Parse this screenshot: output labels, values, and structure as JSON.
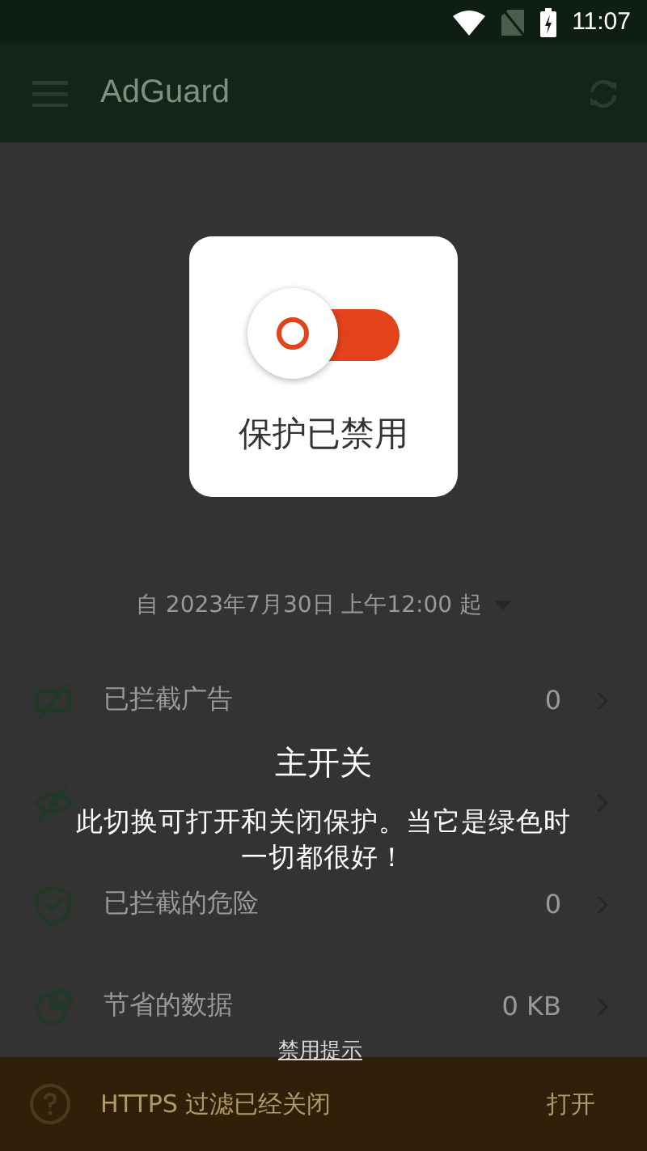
{
  "status_bar": {
    "time": "11:07"
  },
  "toolbar": {
    "title": "AdGuard"
  },
  "protection_card": {
    "on": false,
    "label": "保护已禁用"
  },
  "date_filter": "自 2023年7月30日 上午12:00 起",
  "stats": [
    {
      "kind": "ads",
      "label": "已拦截广告",
      "value": "0"
    },
    {
      "kind": "trackers"
    },
    {
      "kind": "threats",
      "label": "已拦截的危险",
      "value": "0"
    },
    {
      "kind": "data",
      "label": "节省的数据",
      "value": "0 KB"
    }
  ],
  "https_banner": {
    "message": "HTTPS 过滤已经关闭",
    "action": "打开"
  },
  "hint": {
    "title": "主开关",
    "text": "此切换可打开和关闭保护。当它是绿色时一切都很好！",
    "dismiss": "禁用提示"
  }
}
